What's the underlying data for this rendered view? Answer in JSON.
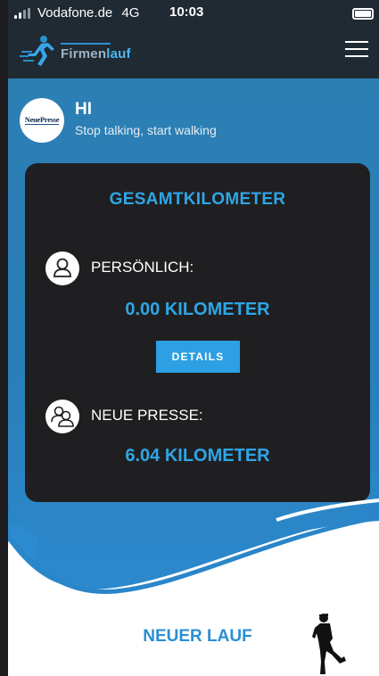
{
  "status_bar": {
    "carrier": "Vodafone.de",
    "network": "4G",
    "time": "10:03"
  },
  "header": {
    "logo_prefix": "Firmen",
    "logo_suffix": "lauf",
    "menu_icon": "hamburger-icon"
  },
  "greeting": {
    "avatar_text": "NeuePresse",
    "name": "HI",
    "slogan": "Stop talking, start walking"
  },
  "summary": {
    "title": "GESAMTKILOMETER",
    "personal_label": "PERSÖNLICH:",
    "personal_value": "0.00 KILOMETER",
    "details_button": "DETAILS",
    "team_label": "NEUE PRESSE:",
    "team_value": "6.04 KILOMETER"
  },
  "footer": {
    "new_run_label": "NEUER LAUF"
  },
  "colors": {
    "header_bg": "#1f2a33",
    "blue_bg": "#2a7fb9",
    "card_bg": "#1f1f21",
    "accent": "#2ea6e6",
    "button": "#2d9fe2"
  }
}
